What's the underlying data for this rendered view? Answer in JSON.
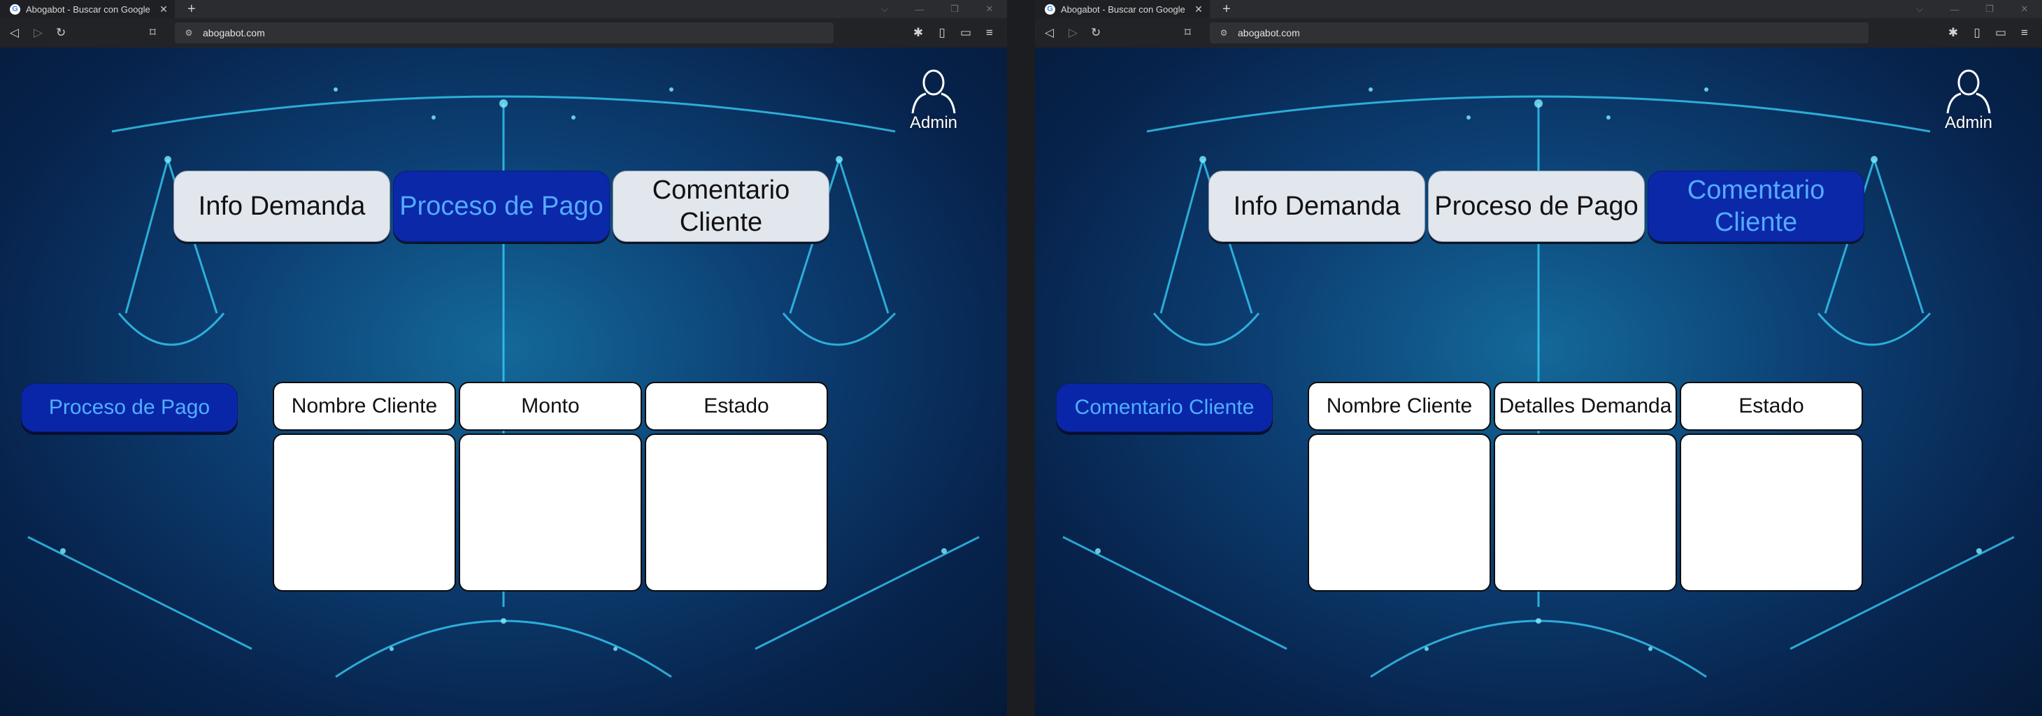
{
  "windows": [
    {
      "id": "left",
      "browser": {
        "tab_title": "Abogabot - Buscar con Google",
        "favicon_letter": "G",
        "tab_close": "✕",
        "new_tab": "+",
        "url": "abogabot.com"
      },
      "user": {
        "label": "Admin",
        "icon": "user-icon"
      },
      "nav_tabs": [
        {
          "label": "Info Demanda",
          "active": false
        },
        {
          "label": "Proceso de Pago",
          "active": true
        },
        {
          "label": "Comentario Cliente",
          "active": false
        }
      ],
      "section_title": "Proceso de Pago",
      "table": {
        "headers": [
          "Nombre Cliente",
          "Monto",
          "Estado"
        ],
        "rows": [
          [
            "",
            "",
            ""
          ]
        ]
      }
    },
    {
      "id": "right",
      "browser": {
        "tab_title": "Abogabot - Buscar con Google",
        "favicon_letter": "G",
        "tab_close": "✕",
        "new_tab": "+",
        "url": "abogabot.com"
      },
      "user": {
        "label": "Admin",
        "icon": "user-icon"
      },
      "nav_tabs": [
        {
          "label": "Info Demanda",
          "active": false
        },
        {
          "label": "Proceso de Pago",
          "active": false
        },
        {
          "label": "Comentario Cliente",
          "active": true
        }
      ],
      "section_title": "Comentario Cliente",
      "table": {
        "headers": [
          "Nombre Cliente",
          "Detalles Demanda",
          "Estado"
        ],
        "rows": [
          [
            "",
            "",
            ""
          ]
        ]
      }
    }
  ],
  "colors": {
    "active_tab_bg": "#0a28a8",
    "active_tab_text": "#55aaff",
    "inactive_tab_bg": "#e2e6ed",
    "page_bg": "#0c3e72",
    "glow": "#38d6ff"
  }
}
